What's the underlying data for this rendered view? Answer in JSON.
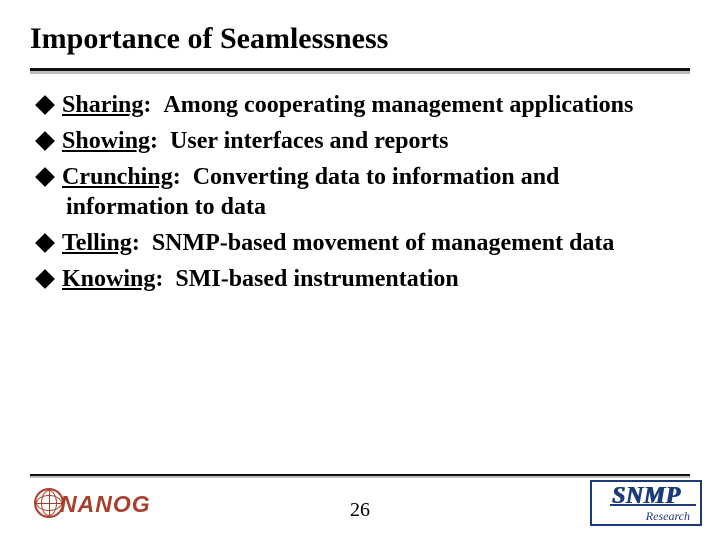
{
  "title": "Importance of Seamlessness",
  "bullets": [
    {
      "label": "Sharing",
      "desc": "Among cooperating management applications"
    },
    {
      "label": "Showing",
      "desc": "User interfaces and reports"
    },
    {
      "label": "Crunching",
      "desc": "Converting data to information and information to data"
    },
    {
      "label": "Telling",
      "desc": "SNMP-based movement of management data"
    },
    {
      "label": "Knowing",
      "desc": "SMI-based instrumentation"
    }
  ],
  "page_number": "26",
  "logos": {
    "left": {
      "text": "NANOG"
    },
    "right": {
      "main": "SNMP",
      "sub": "Research"
    }
  }
}
